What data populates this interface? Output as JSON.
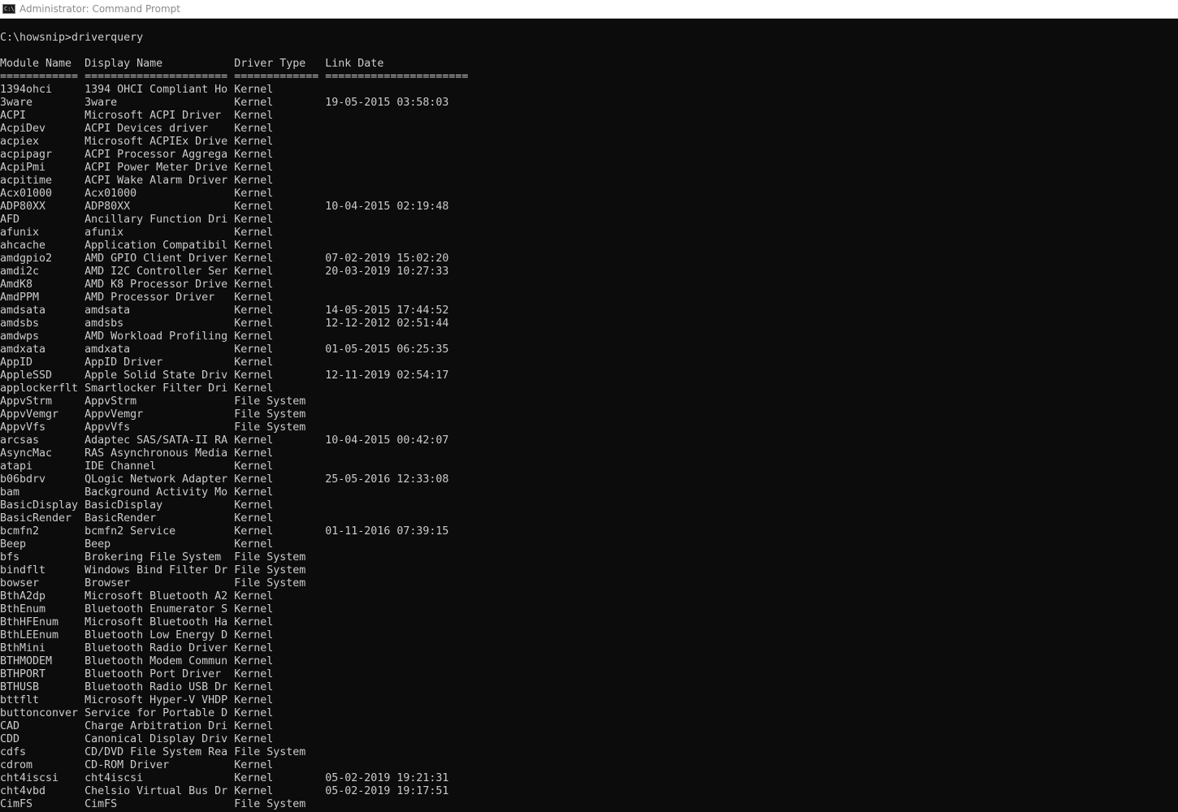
{
  "window": {
    "title": "Administrator: Command Prompt",
    "icon": "cmd-icon",
    "icon_text": "C:\\"
  },
  "console": {
    "prompt": "C:\\howsnip>driverquery",
    "header": "Module Name  Display Name           Driver Type   Link Date",
    "separator": "============ ====================== ============= ======================",
    "rows": [
      {
        "module": "1394ohci",
        "display": "1394 OHCI Compliant Ho",
        "type": "Kernel",
        "date": ""
      },
      {
        "module": "3ware",
        "display": "3ware",
        "type": "Kernel",
        "date": "19-05-2015 03:58:03"
      },
      {
        "module": "ACPI",
        "display": "Microsoft ACPI Driver",
        "type": "Kernel",
        "date": ""
      },
      {
        "module": "AcpiDev",
        "display": "ACPI Devices driver",
        "type": "Kernel",
        "date": ""
      },
      {
        "module": "acpiex",
        "display": "Microsoft ACPIEx Drive",
        "type": "Kernel",
        "date": ""
      },
      {
        "module": "acpipagr",
        "display": "ACPI Processor Aggrega",
        "type": "Kernel",
        "date": ""
      },
      {
        "module": "AcpiPmi",
        "display": "ACPI Power Meter Drive",
        "type": "Kernel",
        "date": ""
      },
      {
        "module": "acpitime",
        "display": "ACPI Wake Alarm Driver",
        "type": "Kernel",
        "date": ""
      },
      {
        "module": "Acx01000",
        "display": "Acx01000",
        "type": "Kernel",
        "date": ""
      },
      {
        "module": "ADP80XX",
        "display": "ADP80XX",
        "type": "Kernel",
        "date": "10-04-2015 02:19:48"
      },
      {
        "module": "AFD",
        "display": "Ancillary Function Dri",
        "type": "Kernel",
        "date": ""
      },
      {
        "module": "afunix",
        "display": "afunix",
        "type": "Kernel",
        "date": ""
      },
      {
        "module": "ahcache",
        "display": "Application Compatibil",
        "type": "Kernel",
        "date": ""
      },
      {
        "module": "amdgpio2",
        "display": "AMD GPIO Client Driver",
        "type": "Kernel",
        "date": "07-02-2019 15:02:20"
      },
      {
        "module": "amdi2c",
        "display": "AMD I2C Controller Ser",
        "type": "Kernel",
        "date": "20-03-2019 10:27:33"
      },
      {
        "module": "AmdK8",
        "display": "AMD K8 Processor Drive",
        "type": "Kernel",
        "date": ""
      },
      {
        "module": "AmdPPM",
        "display": "AMD Processor Driver",
        "type": "Kernel",
        "date": ""
      },
      {
        "module": "amdsata",
        "display": "amdsata",
        "type": "Kernel",
        "date": "14-05-2015 17:44:52"
      },
      {
        "module": "amdsbs",
        "display": "amdsbs",
        "type": "Kernel",
        "date": "12-12-2012 02:51:44"
      },
      {
        "module": "amdwps",
        "display": "AMD Workload Profiling",
        "type": "Kernel",
        "date": ""
      },
      {
        "module": "amdxata",
        "display": "amdxata",
        "type": "Kernel",
        "date": "01-05-2015 06:25:35"
      },
      {
        "module": "AppID",
        "display": "AppID Driver",
        "type": "Kernel",
        "date": ""
      },
      {
        "module": "AppleSSD",
        "display": "Apple Solid State Driv",
        "type": "Kernel",
        "date": "12-11-2019 02:54:17"
      },
      {
        "module": "applockerflt",
        "display": "Smartlocker Filter Dri",
        "type": "Kernel",
        "date": ""
      },
      {
        "module": "AppvStrm",
        "display": "AppvStrm",
        "type": "File System",
        "date": ""
      },
      {
        "module": "AppvVemgr",
        "display": "AppvVemgr",
        "type": "File System",
        "date": ""
      },
      {
        "module": "AppvVfs",
        "display": "AppvVfs",
        "type": "File System",
        "date": ""
      },
      {
        "module": "arcsas",
        "display": "Adaptec SAS/SATA-II RA",
        "type": "Kernel",
        "date": "10-04-2015 00:42:07"
      },
      {
        "module": "AsyncMac",
        "display": "RAS Asynchronous Media",
        "type": "Kernel",
        "date": ""
      },
      {
        "module": "atapi",
        "display": "IDE Channel",
        "type": "Kernel",
        "date": ""
      },
      {
        "module": "b06bdrv",
        "display": "QLogic Network Adapter",
        "type": "Kernel",
        "date": "25-05-2016 12:33:08"
      },
      {
        "module": "bam",
        "display": "Background Activity Mo",
        "type": "Kernel",
        "date": ""
      },
      {
        "module": "BasicDisplay",
        "display": "BasicDisplay",
        "type": "Kernel",
        "date": ""
      },
      {
        "module": "BasicRender",
        "display": "BasicRender",
        "type": "Kernel",
        "date": ""
      },
      {
        "module": "bcmfn2",
        "display": "bcmfn2 Service",
        "type": "Kernel",
        "date": "01-11-2016 07:39:15"
      },
      {
        "module": "Beep",
        "display": "Beep",
        "type": "Kernel",
        "date": ""
      },
      {
        "module": "bfs",
        "display": "Brokering File System",
        "type": "File System",
        "date": ""
      },
      {
        "module": "bindflt",
        "display": "Windows Bind Filter Dr",
        "type": "File System",
        "date": ""
      },
      {
        "module": "bowser",
        "display": "Browser",
        "type": "File System",
        "date": ""
      },
      {
        "module": "BthA2dp",
        "display": "Microsoft Bluetooth A2",
        "type": "Kernel",
        "date": ""
      },
      {
        "module": "BthEnum",
        "display": "Bluetooth Enumerator S",
        "type": "Kernel",
        "date": ""
      },
      {
        "module": "BthHFEnum",
        "display": "Microsoft Bluetooth Ha",
        "type": "Kernel",
        "date": ""
      },
      {
        "module": "BthLEEnum",
        "display": "Bluetooth Low Energy D",
        "type": "Kernel",
        "date": ""
      },
      {
        "module": "BthMini",
        "display": "Bluetooth Radio Driver",
        "type": "Kernel",
        "date": ""
      },
      {
        "module": "BTHMODEM",
        "display": "Bluetooth Modem Commun",
        "type": "Kernel",
        "date": ""
      },
      {
        "module": "BTHPORT",
        "display": "Bluetooth Port Driver",
        "type": "Kernel",
        "date": ""
      },
      {
        "module": "BTHUSB",
        "display": "Bluetooth Radio USB Dr",
        "type": "Kernel",
        "date": ""
      },
      {
        "module": "bttflt",
        "display": "Microsoft Hyper-V VHDP",
        "type": "Kernel",
        "date": ""
      },
      {
        "module": "buttonconver",
        "display": "Service for Portable D",
        "type": "Kernel",
        "date": ""
      },
      {
        "module": "CAD",
        "display": "Charge Arbitration Dri",
        "type": "Kernel",
        "date": ""
      },
      {
        "module": "CDD",
        "display": "Canonical Display Driv",
        "type": "Kernel",
        "date": ""
      },
      {
        "module": "cdfs",
        "display": "CD/DVD File System Rea",
        "type": "File System",
        "date": ""
      },
      {
        "module": "cdrom",
        "display": "CD-ROM Driver",
        "type": "Kernel",
        "date": ""
      },
      {
        "module": "cht4iscsi",
        "display": "cht4iscsi",
        "type": "Kernel",
        "date": "05-02-2019 19:21:31"
      },
      {
        "module": "cht4vbd",
        "display": "Chelsio Virtual Bus Dr",
        "type": "Kernel",
        "date": "05-02-2019 19:17:51"
      },
      {
        "module": "CimFS",
        "display": "CimFS",
        "type": "File System",
        "date": ""
      }
    ]
  },
  "colors": {
    "background": "#0c0c0c",
    "text": "#cccccc",
    "titlebar": "#ffffff",
    "title_text": "#8a8a8a"
  }
}
